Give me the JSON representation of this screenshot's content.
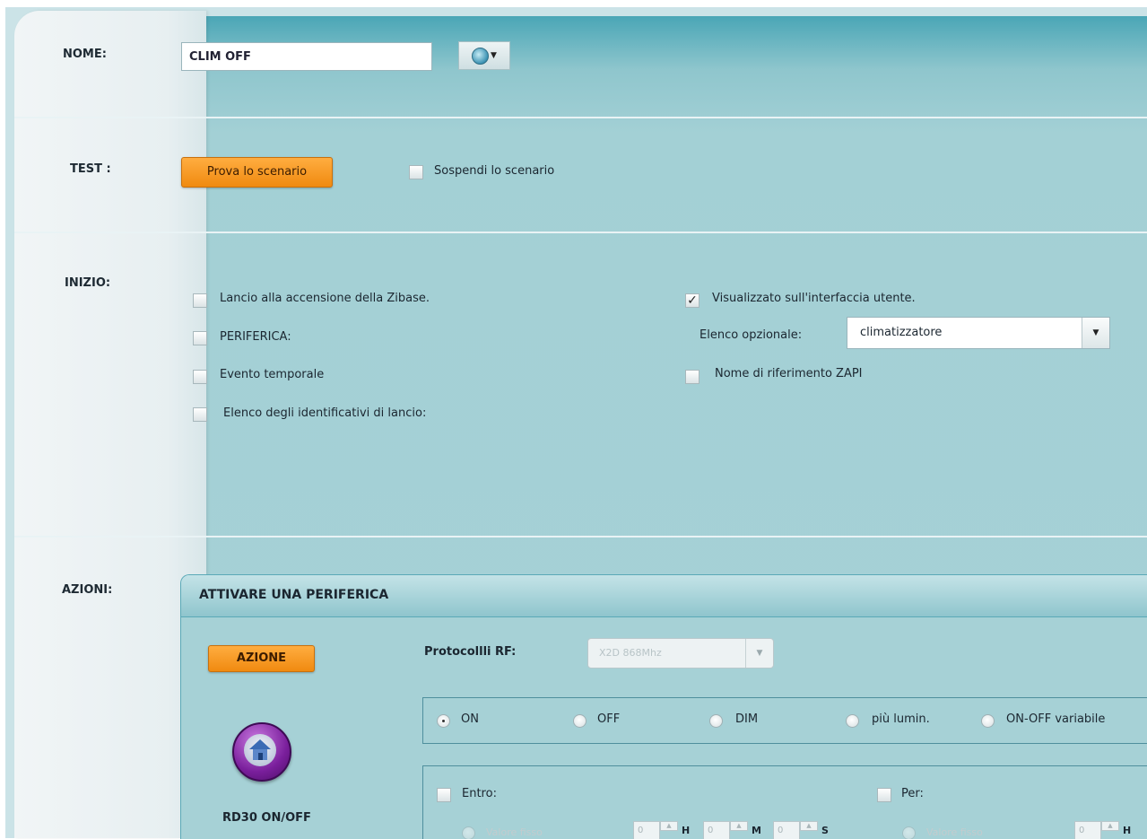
{
  "sections": {
    "nome": {
      "label": "NOME:",
      "value": "CLIM OFF"
    },
    "test": {
      "label": "TEST :",
      "try_button": "Prova lo scenario",
      "suspend_label": "Sospendi lo scenario"
    },
    "inizio": {
      "label": "INIZIO:",
      "launch_on_power": "Lancio alla accensione della Zibase.",
      "periferica": "PERIFERICA:",
      "evento": "Evento temporale",
      "identifiers": "Elenco degli identificativi di lancio:",
      "ui_visible": "Visualizzato sull'interfaccia utente.",
      "optional_list_label": "Elenco opzionale:",
      "optional_list_value": "climatizzatore",
      "zapi_label": "Nome di riferimento ZAPI"
    },
    "azioni": {
      "label": "AZIONI:"
    }
  },
  "panel": {
    "title": "ATTIVARE UNA PERIFERICA",
    "action_button": "AZIONE",
    "rf_label": "Protocollli RF:",
    "rf_value": "X2D 868Mhz",
    "device_name": "RD30 ON/OFF",
    "modes": [
      "ON",
      "OFF",
      "DIM",
      "più lumin.",
      "ON-OFF variabile"
    ],
    "selected_mode": "ON",
    "entro_label": "Entro:",
    "per_label": "Per:",
    "fixed_value_label": "Valore fisso",
    "spin_values": [
      "0",
      "0",
      "0",
      "0"
    ],
    "units": [
      "H",
      "M",
      "S",
      "H"
    ]
  },
  "checks": {
    "ui_visible": true
  },
  "colors": {
    "accent_orange": "#f08a10",
    "panel_teal": "#a6d1d6",
    "header_teal": "#4aa6b6",
    "icon_purple": "#7a1f9c"
  },
  "icons": {
    "language": "globe-icon",
    "device": "house-icon"
  }
}
